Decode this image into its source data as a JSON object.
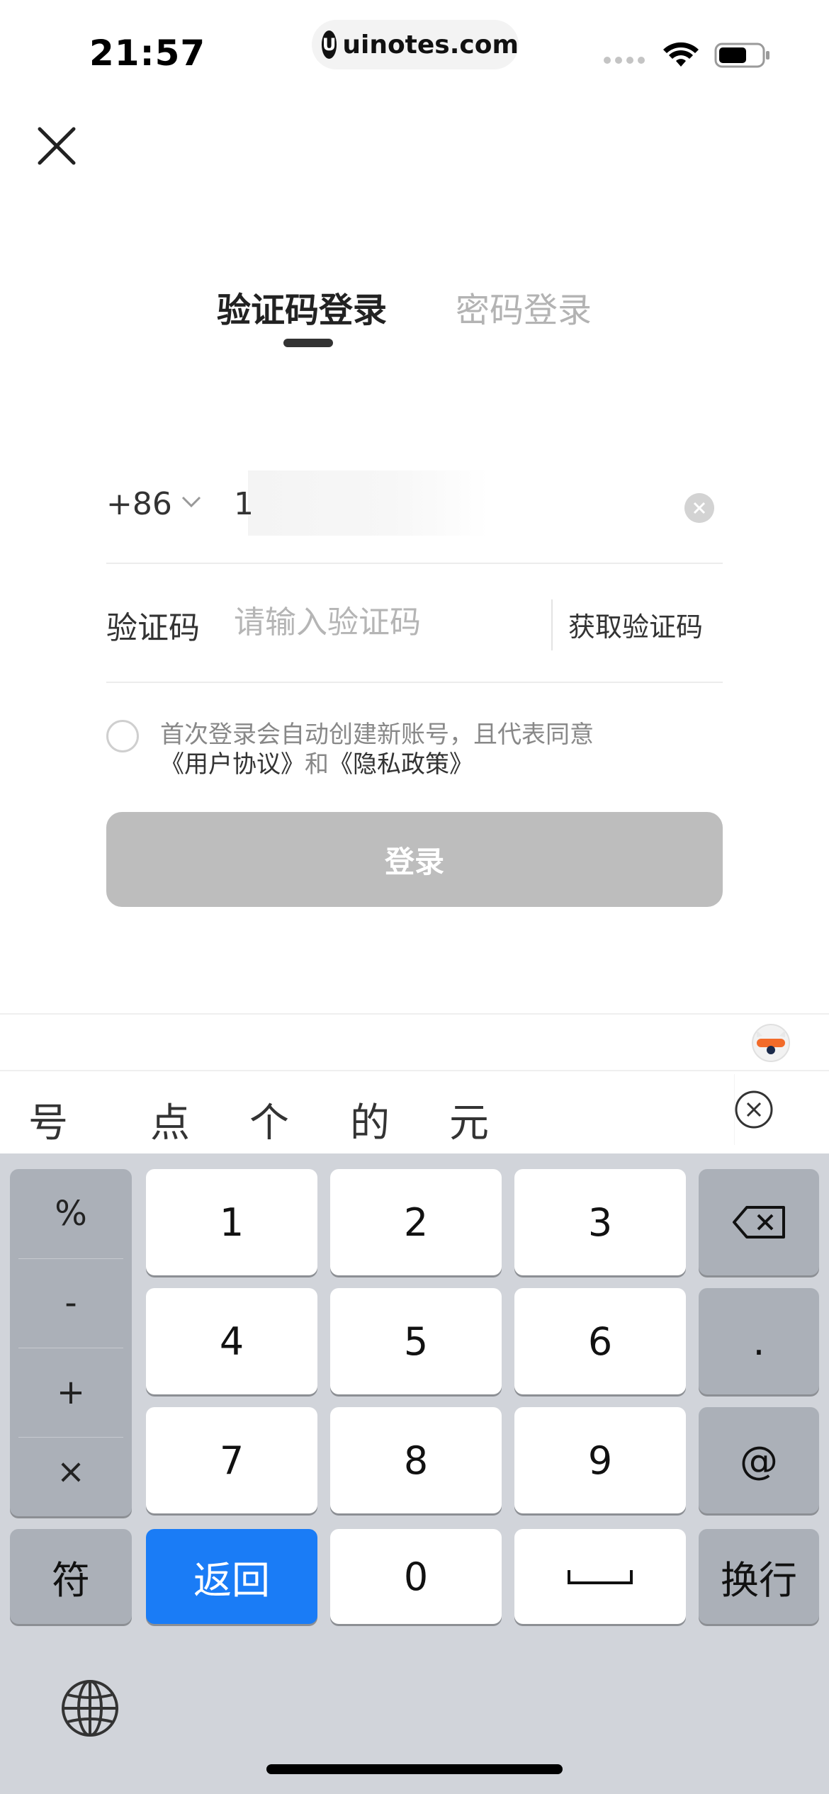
{
  "status_bar": {
    "time": "21:57",
    "url": "uinotes.com",
    "url_logo": "U"
  },
  "tabs": {
    "active": "验证码登录",
    "inactive": "密码登录"
  },
  "form": {
    "country_code": "+86",
    "phone_value": "1",
    "code_label": "验证码",
    "code_placeholder": "请输入验证码",
    "get_code": "获取验证码",
    "agreement_prefix": "首次登录会自动创建新账号，且代表同意",
    "agreement_link1": "《用户协议》",
    "agreement_middle": "和",
    "agreement_link2": "《隐私政策》",
    "login_button": "登录"
  },
  "candidates": [
    "号",
    "点",
    "个",
    "的",
    "元"
  ],
  "keyboard": {
    "symbols": [
      "%",
      "-",
      "+",
      "×"
    ],
    "digits": [
      "1",
      "2",
      "3",
      "4",
      "5",
      "6",
      "7",
      "8",
      "9",
      "0"
    ],
    "dot": ".",
    "at": "@",
    "symbol_key": "符",
    "return_key": "返回",
    "newline_key": "换行"
  },
  "colors": {
    "accent": "#1a7cf6",
    "login_disabled": "#bdbdbd",
    "keyboard_bg": "#d1d4da"
  },
  "icons": [
    "close-icon",
    "chevron-down-icon",
    "clear-input-icon",
    "backspace-icon",
    "globe-icon",
    "wifi-icon",
    "battery-icon",
    "mascot-icon",
    "candidate-close-icon",
    "space-icon"
  ]
}
